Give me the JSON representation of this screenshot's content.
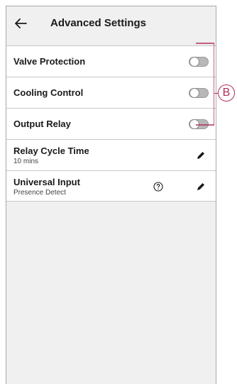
{
  "header": {
    "title": "Advanced Settings"
  },
  "settings": {
    "rows": [
      {
        "label": "Valve Protection",
        "toggle": "off"
      },
      {
        "label": "Cooling Control",
        "toggle": "off"
      },
      {
        "label": "Output Relay",
        "toggle": "off"
      },
      {
        "label": "Relay Cycle Time",
        "value": "10 mins"
      },
      {
        "label": "Universal Input",
        "value": "Presence Detect"
      }
    ]
  },
  "annotation": {
    "callout_label": "B",
    "color": "#b0305a"
  }
}
